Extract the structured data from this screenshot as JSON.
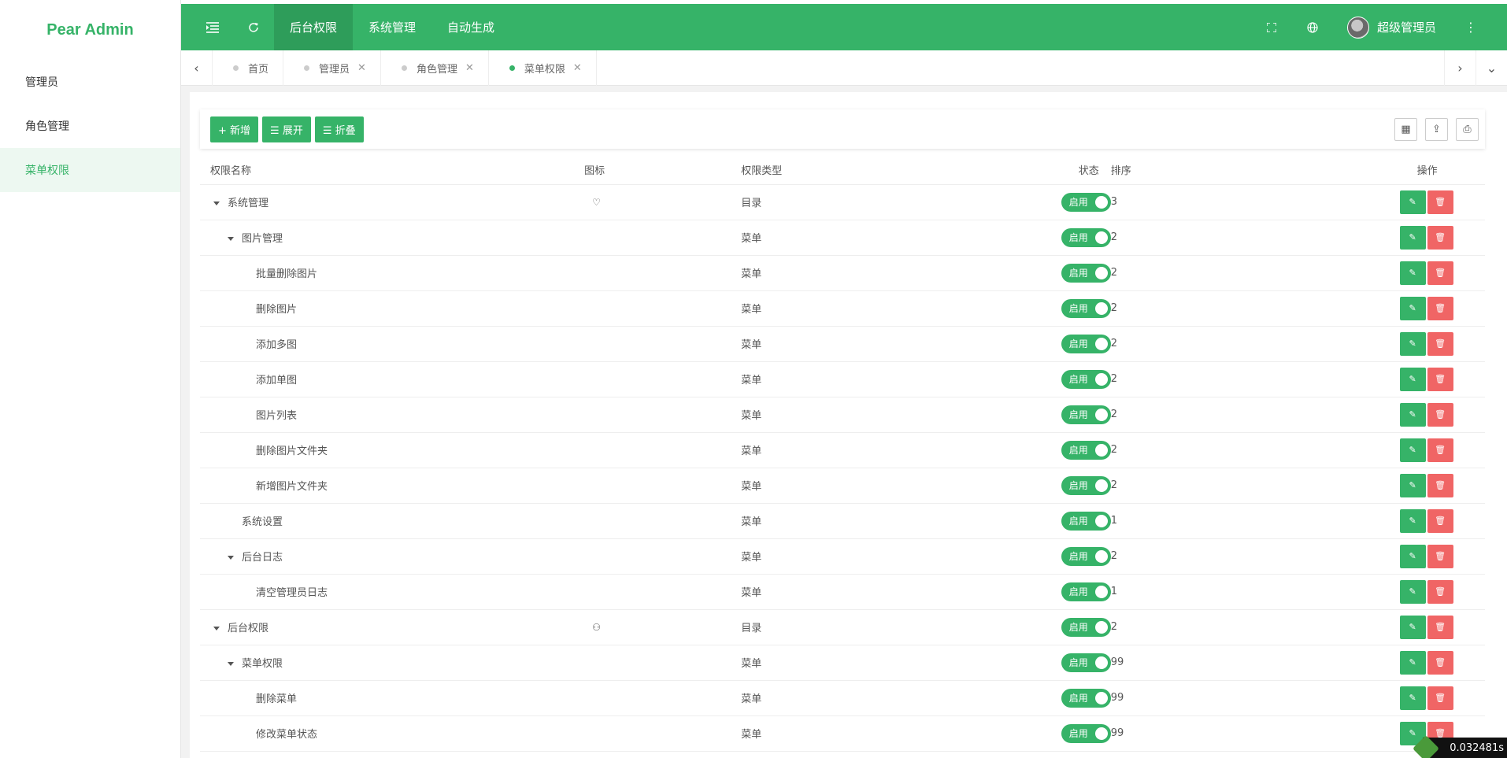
{
  "app": {
    "logo": "Pear Admin"
  },
  "sidebar": {
    "items": [
      {
        "label": "管理员",
        "active": false
      },
      {
        "label": "角色管理",
        "active": false
      },
      {
        "label": "菜单权限",
        "active": true
      }
    ]
  },
  "header": {
    "nav": [
      {
        "label": "后台权限"
      },
      {
        "label": "系统管理"
      },
      {
        "label": "自动生成"
      }
    ],
    "user_name": "超级管理员"
  },
  "tabs": [
    {
      "label": "首页"
    },
    {
      "label": "管理员"
    },
    {
      "label": "角色管理"
    },
    {
      "label": "菜单权限"
    }
  ],
  "toolbar": {
    "add": "+ 新增",
    "expand": "☰ 展开",
    "collapse": "☰ 折叠"
  },
  "table": {
    "columns": {
      "name": "权限名称",
      "icon": "图标",
      "type": "权限类型",
      "status": "状态",
      "sort": "排序",
      "op": "操作"
    },
    "status_label": "启用",
    "rows": [
      {
        "name": "系统管理",
        "level": 1,
        "caret": true,
        "icon": "♡",
        "type": "目录",
        "sort": "3"
      },
      {
        "name": "图片管理",
        "level": 2,
        "caret": true,
        "icon": "",
        "type": "菜单",
        "sort": "2"
      },
      {
        "name": "批量删除图片",
        "level": 3,
        "caret": false,
        "icon": "",
        "type": "菜单",
        "sort": "2"
      },
      {
        "name": "删除图片",
        "level": 3,
        "caret": false,
        "icon": "",
        "type": "菜单",
        "sort": "2"
      },
      {
        "name": "添加多图",
        "level": 3,
        "caret": false,
        "icon": "",
        "type": "菜单",
        "sort": "2"
      },
      {
        "name": "添加单图",
        "level": 3,
        "caret": false,
        "icon": "",
        "type": "菜单",
        "sort": "2"
      },
      {
        "name": "图片列表",
        "level": 3,
        "caret": false,
        "icon": "",
        "type": "菜单",
        "sort": "2"
      },
      {
        "name": "删除图片文件夹",
        "level": 3,
        "caret": false,
        "icon": "",
        "type": "菜单",
        "sort": "2"
      },
      {
        "name": "新增图片文件夹",
        "level": 3,
        "caret": false,
        "icon": "",
        "type": "菜单",
        "sort": "2"
      },
      {
        "name": "系统设置",
        "level": 2,
        "caret": false,
        "icon": "",
        "type": "菜单",
        "sort": "1"
      },
      {
        "name": "后台日志",
        "level": 2,
        "caret": true,
        "icon": "",
        "type": "菜单",
        "sort": "2"
      },
      {
        "name": "清空管理员日志",
        "level": 3,
        "caret": false,
        "icon": "",
        "type": "菜单",
        "sort": "1"
      },
      {
        "name": "后台权限",
        "level": 1,
        "caret": true,
        "icon": "⚇",
        "type": "目录",
        "sort": "2"
      },
      {
        "name": "菜单权限",
        "level": 2,
        "caret": true,
        "icon": "",
        "type": "菜单",
        "sort": "99"
      },
      {
        "name": "删除菜单",
        "level": 3,
        "caret": false,
        "icon": "",
        "type": "菜单",
        "sort": "99"
      },
      {
        "name": "修改菜单状态",
        "level": 3,
        "caret": false,
        "icon": "",
        "type": "菜单",
        "sort": "99"
      }
    ]
  },
  "timer": "0.032481s"
}
